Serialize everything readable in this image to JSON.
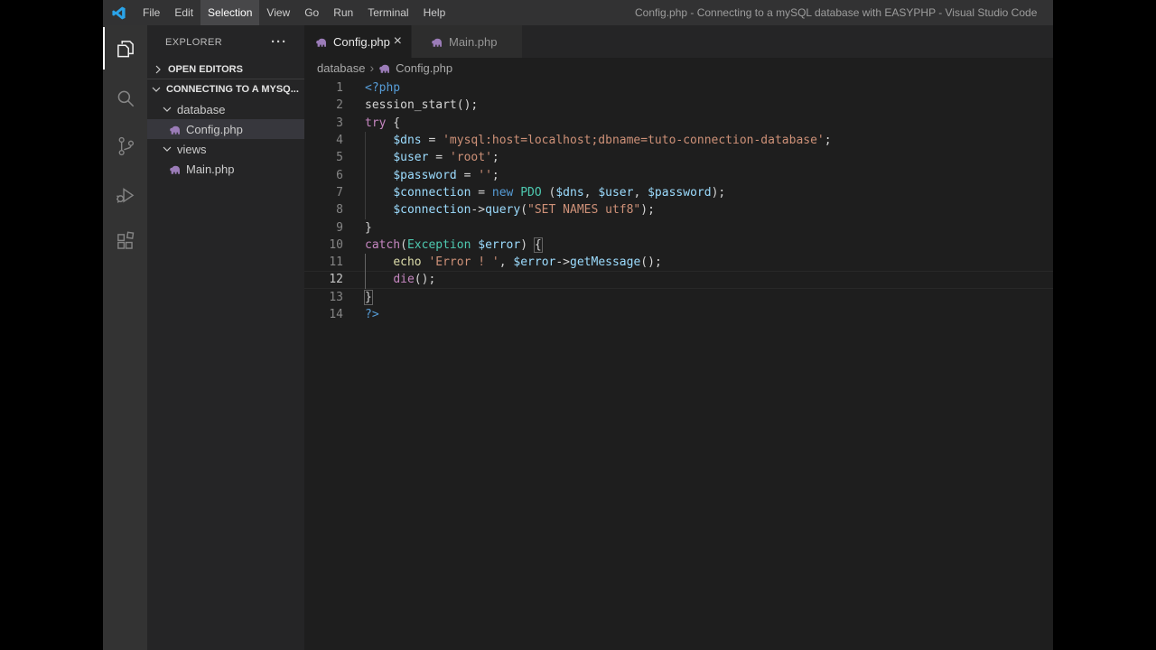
{
  "window": {
    "title": "Config.php - Connecting to a mySQL database with EASYPHP - Visual Studio Code"
  },
  "menu": {
    "items": [
      "File",
      "Edit",
      "Selection",
      "View",
      "Go",
      "Run",
      "Terminal",
      "Help"
    ],
    "active": "Selection"
  },
  "activity_bar": {
    "items": [
      {
        "name": "explorer",
        "icon": "explorer",
        "active": true
      },
      {
        "name": "search",
        "icon": "search",
        "active": false
      },
      {
        "name": "source-control",
        "icon": "source-control",
        "active": false
      },
      {
        "name": "run-debug",
        "icon": "run-debug",
        "active": false
      },
      {
        "name": "extensions",
        "icon": "extensions",
        "active": false
      }
    ]
  },
  "sidebar": {
    "title": "EXPLORER",
    "ellipsis": "···",
    "open_editors_label": "OPEN EDITORS",
    "workspace_label": "CONNECTING TO A MYSQ...",
    "tree": [
      {
        "label": "database",
        "type": "folder",
        "indent": 1,
        "expanded": true,
        "selected": false
      },
      {
        "label": "Config.php",
        "type": "php-file",
        "indent": 2,
        "selected": true
      },
      {
        "label": "views",
        "type": "folder",
        "indent": 1,
        "expanded": true,
        "selected": false
      },
      {
        "label": "Main.php",
        "type": "php-file",
        "indent": 2,
        "selected": false
      }
    ]
  },
  "tabs": [
    {
      "label": "Config.php",
      "active": true,
      "close_glyph": "×"
    },
    {
      "label": "Main.php",
      "active": false
    }
  ],
  "breadcrumb": {
    "folder": "database",
    "separator": "›",
    "file": "Config.php"
  },
  "editor": {
    "current_line": 12,
    "lines": [
      {
        "n": 1,
        "segs": [
          {
            "t": "<?php",
            "c": "tag"
          }
        ]
      },
      {
        "n": 2,
        "segs": [
          {
            "t": "session_start();",
            "c": "fg"
          }
        ]
      },
      {
        "n": 3,
        "segs": [
          {
            "t": "try",
            "c": "kw"
          },
          {
            "t": " {",
            "c": "fg"
          }
        ]
      },
      {
        "n": 4,
        "g": true,
        "segs": [
          {
            "t": "    ",
            "c": "fg"
          },
          {
            "t": "$dns",
            "c": "var"
          },
          {
            "t": " = ",
            "c": "fg"
          },
          {
            "t": "'mysql:host=localhost;dbname=tuto-connection-database'",
            "c": "str"
          },
          {
            "t": ";",
            "c": "fg"
          }
        ]
      },
      {
        "n": 5,
        "g": true,
        "segs": [
          {
            "t": "    ",
            "c": "fg"
          },
          {
            "t": "$user",
            "c": "var"
          },
          {
            "t": " = ",
            "c": "fg"
          },
          {
            "t": "'root'",
            "c": "str"
          },
          {
            "t": ";",
            "c": "fg"
          }
        ]
      },
      {
        "n": 6,
        "g": true,
        "segs": [
          {
            "t": "    ",
            "c": "fg"
          },
          {
            "t": "$password",
            "c": "var"
          },
          {
            "t": " = ",
            "c": "fg"
          },
          {
            "t": "''",
            "c": "str"
          },
          {
            "t": ";",
            "c": "fg"
          }
        ]
      },
      {
        "n": 7,
        "g": true,
        "segs": [
          {
            "t": "    ",
            "c": "fg"
          },
          {
            "t": "$connection",
            "c": "var"
          },
          {
            "t": " = ",
            "c": "fg"
          },
          {
            "t": "new",
            "c": "tag"
          },
          {
            "t": " ",
            "c": "fg"
          },
          {
            "t": "PDO",
            "c": "cls"
          },
          {
            "t": " (",
            "c": "fg"
          },
          {
            "t": "$dns",
            "c": "var"
          },
          {
            "t": ", ",
            "c": "fg"
          },
          {
            "t": "$user",
            "c": "var"
          },
          {
            "t": ", ",
            "c": "fg"
          },
          {
            "t": "$password",
            "c": "var"
          },
          {
            "t": ");",
            "c": "fg"
          }
        ]
      },
      {
        "n": 8,
        "g": true,
        "segs": [
          {
            "t": "    ",
            "c": "fg"
          },
          {
            "t": "$connection",
            "c": "var"
          },
          {
            "t": "->",
            "c": "fg"
          },
          {
            "t": "query",
            "c": "var"
          },
          {
            "t": "(",
            "c": "fg"
          },
          {
            "t": "\"SET NAMES utf8\"",
            "c": "str"
          },
          {
            "t": ");",
            "c": "fg"
          }
        ]
      },
      {
        "n": 9,
        "segs": [
          {
            "t": "}",
            "c": "fg"
          }
        ]
      },
      {
        "n": 10,
        "segs": [
          {
            "t": "catch",
            "c": "kw"
          },
          {
            "t": "(",
            "c": "fg"
          },
          {
            "t": "Exception",
            "c": "cls"
          },
          {
            "t": " ",
            "c": "fg"
          },
          {
            "t": "$error",
            "c": "var"
          },
          {
            "t": ") ",
            "c": "fg"
          },
          {
            "t": "{",
            "c": "fg",
            "m": true
          }
        ]
      },
      {
        "n": 11,
        "g": "active",
        "segs": [
          {
            "t": "    ",
            "c": "fg"
          },
          {
            "t": "echo",
            "c": "fn"
          },
          {
            "t": " ",
            "c": "fg"
          },
          {
            "t": "'Error ! '",
            "c": "str"
          },
          {
            "t": ", ",
            "c": "fg"
          },
          {
            "t": "$error",
            "c": "var"
          },
          {
            "t": "->",
            "c": "fg"
          },
          {
            "t": "getMessage",
            "c": "var"
          },
          {
            "t": "();",
            "c": "fg"
          }
        ]
      },
      {
        "n": 12,
        "g": "active",
        "segs": [
          {
            "t": "    ",
            "c": "fg"
          },
          {
            "t": "die",
            "c": "kw"
          },
          {
            "t": "();",
            "c": "fg"
          }
        ]
      },
      {
        "n": 13,
        "segs": [
          {
            "t": "}",
            "c": "fg",
            "m": true
          }
        ]
      },
      {
        "n": 14,
        "segs": [
          {
            "t": "?>",
            "c": "tag"
          }
        ]
      }
    ]
  },
  "colors": {
    "fg": "#d4d4d4",
    "tag": "#569cd6",
    "kw": "#c586c0",
    "var": "#9cdcfe",
    "str": "#ce9178",
    "cls": "#4ec9b0",
    "fn": "#dcdcaa",
    "php_icon": "#9b7cb8",
    "accent_logo": "#2aa3e8"
  }
}
